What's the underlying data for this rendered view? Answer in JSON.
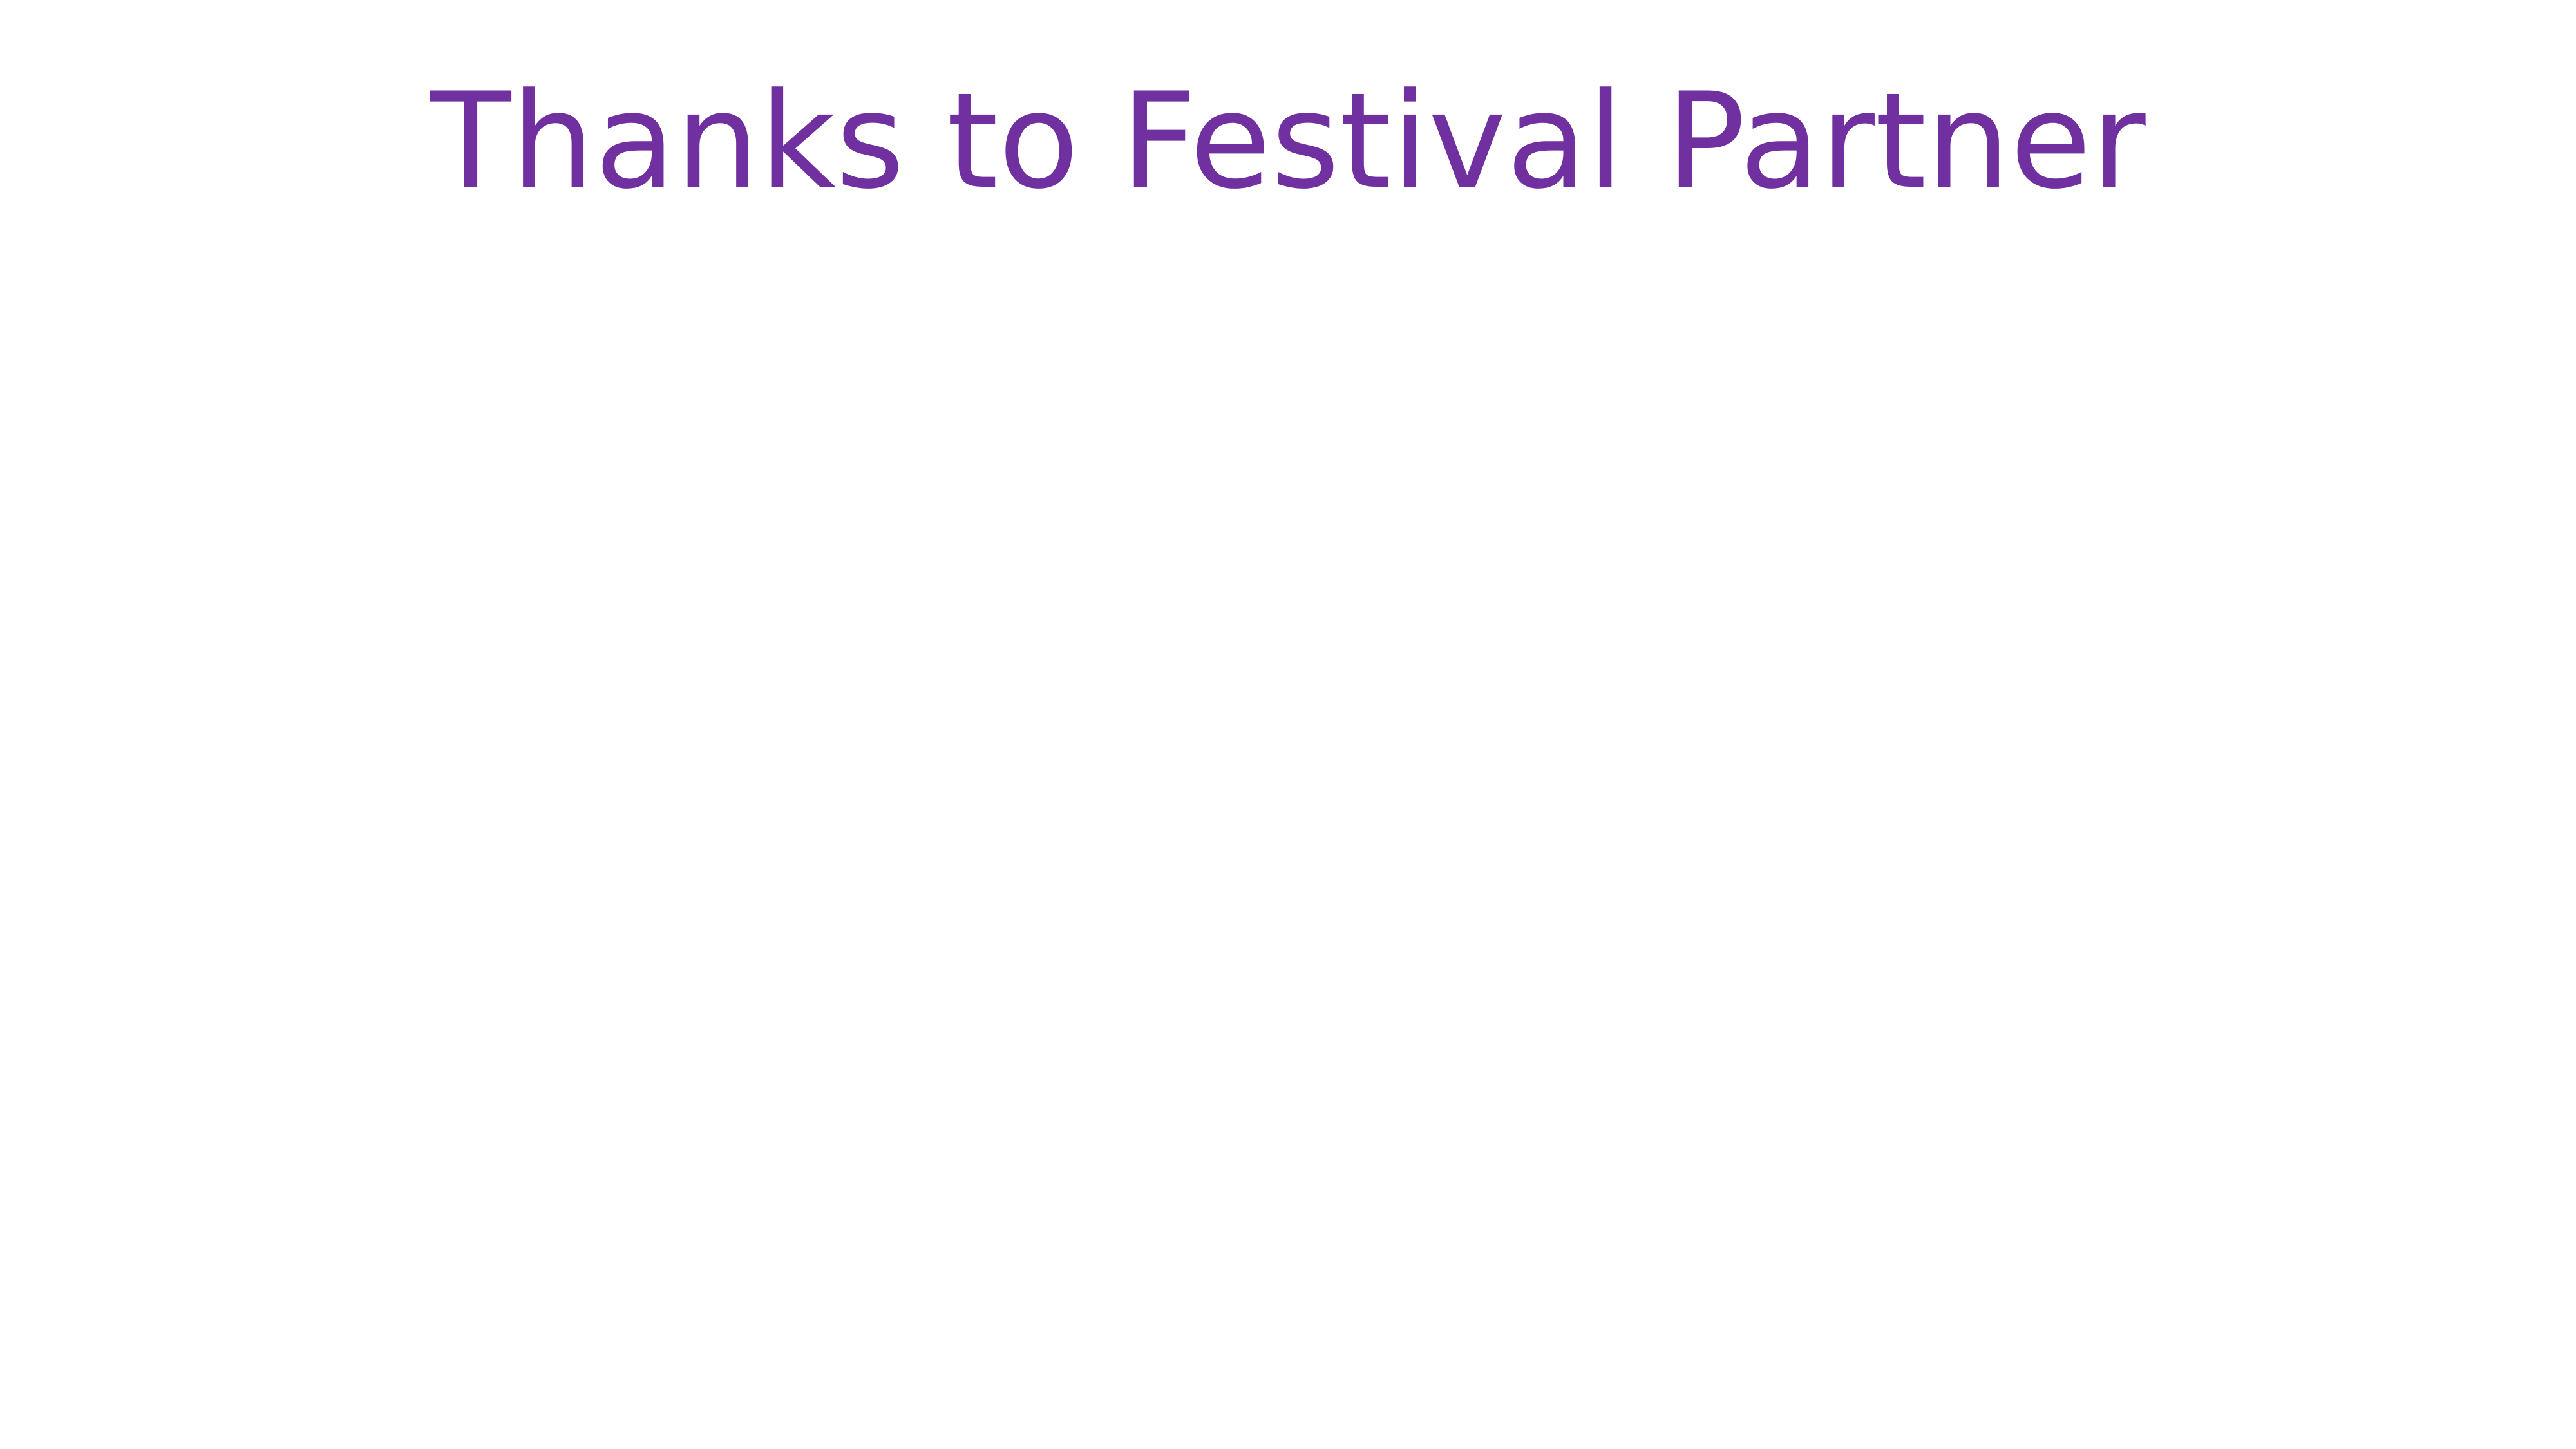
{
  "slide": {
    "title": "Thanks to Festival Partner",
    "title_color": "#7030a0",
    "background_color": "#ffffff"
  }
}
